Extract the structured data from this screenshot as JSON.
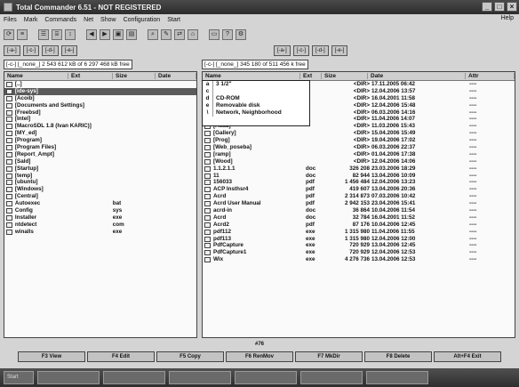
{
  "window": {
    "title": "Total Commander 6.51 - NOT REGISTERED"
  },
  "menu": {
    "items": [
      "Files",
      "Mark",
      "Commands",
      "Net",
      "Show",
      "Configuration",
      "Start"
    ],
    "help": "Help"
  },
  "left_panel": {
    "path": "[-c-] [_none_] 2 543 612 kB of 6 297 468 kB free",
    "columns": [
      "Name",
      "Ext",
      "Size",
      "Date"
    ],
    "rows": [
      [
        "[..]",
        "",
        "",
        ""
      ],
      [
        "[ide-sys]",
        "",
        "",
        ""
      ],
      [
        "[Acoib]",
        "",
        "",
        ""
      ],
      [
        "[Documents and Settings]",
        "",
        "",
        ""
      ],
      [
        "[Freebsd]",
        "",
        "",
        ""
      ],
      [
        "[Intel]",
        "",
        "",
        ""
      ],
      [
        "[MacroSDL 1.8 (Ivan KARIC)]",
        "",
        "",
        ""
      ],
      [
        "[MY_ed]",
        "",
        "",
        ""
      ],
      [
        "[Program]",
        "",
        "",
        ""
      ],
      [
        "[Program Files]",
        "",
        "",
        ""
      ],
      [
        "[Report_Ampt]",
        "",
        "",
        ""
      ],
      [
        "[Sald]",
        "",
        "",
        ""
      ],
      [
        "[Startup]",
        "",
        "",
        ""
      ],
      [
        "[temp]",
        "",
        "",
        ""
      ],
      [
        "[ubuntu]",
        "",
        "",
        ""
      ],
      [
        "[Windows]",
        "",
        "",
        ""
      ],
      [
        "[Central]",
        "",
        "",
        ""
      ],
      [
        "Autoexec",
        "bat",
        "",
        ""
      ],
      [
        "Config",
        "sys",
        "",
        ""
      ],
      [
        "Installer",
        "exe",
        "",
        ""
      ],
      [
        "ntdetect",
        "com",
        "",
        ""
      ],
      [
        "winalls",
        "exe",
        "",
        ""
      ]
    ]
  },
  "right_panel": {
    "path": "[-c-] [_none_] 345 180 of 511 456 k free",
    "columns": [
      "Name",
      "Ext",
      "Size",
      "Date",
      "Attr"
    ],
    "rows": [
      [
        "[..]",
        "",
        "<DIR>",
        "17.11.2005 06:42",
        "----"
      ],
      [
        "[..]",
        "",
        "<DIR>",
        "12.04.2006 13:57",
        "----"
      ],
      [
        "[..]",
        "",
        "<DIR>",
        "16.04.2001 11:58",
        "----"
      ],
      [
        "[..]",
        "",
        "<DIR>",
        "12.04.2006 15:48",
        "----"
      ],
      [
        "[..]",
        "",
        "<DIR>",
        "06.03.2006 14:16",
        "----"
      ],
      [
        "[..]",
        "",
        "<DIR>",
        "11.04.2006 14:07",
        "----"
      ],
      [
        "[Acad]",
        "",
        "<DIR>",
        "11.03.2006 15:43",
        "----"
      ],
      [
        "[Gallery]",
        "",
        "<DIR>",
        "15.04.2006 15:49",
        "----"
      ],
      [
        "[Prog]",
        "",
        "<DIR>",
        "19.04.2006 17:02",
        "----"
      ],
      [
        "[Web_poseba]",
        "",
        "<DIR>",
        "06.03.2006 22:37",
        "----"
      ],
      [
        "[ramp]",
        "",
        "<DIR>",
        "01.04.2006 17:38",
        "----"
      ],
      [
        "[Wood]",
        "",
        "<DIR>",
        "12.04.2006 14:06",
        "----"
      ],
      [
        "1.1.2.1.1",
        "doc",
        "326 208",
        "23.03.2006 18:29",
        "----"
      ],
      [
        "11",
        "doc",
        "82 944",
        "13.04.2006 10:09",
        "----"
      ],
      [
        "156033",
        "pdf",
        "1 456 484",
        "12.04.2006 13:23",
        "----"
      ],
      [
        "ACP Insthsr4",
        "pdf",
        "419 607",
        "13.04.2006 20:36",
        "----"
      ],
      [
        "Acrd",
        "pdf",
        "2 314 873",
        "07.03.2006 10:42",
        "----"
      ],
      [
        "Acrd User Manual",
        "pdf",
        "2 942 153",
        "23.04.2006 15:41",
        "----"
      ],
      [
        "acrd-in",
        "doc",
        "36 864",
        "10.04.2006 11:54",
        "----"
      ],
      [
        "Acrd",
        "doc",
        "32 784",
        "16.04.2001 11:52",
        "----"
      ],
      [
        "Acrd2",
        "pdf",
        "87 176",
        "10.04.2006 12:45",
        "----"
      ],
      [
        "pdf112",
        "exe",
        "1 315 980",
        "11.04.2006 11:55",
        "----"
      ],
      [
        "pdf113",
        "exe",
        "1 315 980",
        "12.04.2006 12:00",
        "----"
      ],
      [
        "PdfCapture",
        "exe",
        "720 929",
        "13.04.2006 12:45",
        "----"
      ],
      [
        "PdfCapture1",
        "exe",
        "720 929",
        "12.04.2006 12:53",
        "----"
      ],
      [
        "Wix",
        "exe",
        "4 276 736",
        "13.04.2006 12:53",
        "----"
      ]
    ]
  },
  "dropdown": {
    "items": [
      {
        "key": "a",
        "label": "3 1/2\""
      },
      {
        "key": "c",
        "label": ""
      },
      {
        "key": "d",
        "label": "CD-ROM"
      },
      {
        "key": "e",
        "label": "Removable disk"
      },
      {
        "key": "\\",
        "label": "Network, Neighborhood"
      }
    ]
  },
  "status": "#76",
  "fkeys": [
    "F3 View",
    "F4 Edit",
    "F5 Copy",
    "F6 RenMov",
    "F7 MkDir",
    "F8 Delete",
    "Alt+F4 Exit"
  ],
  "taskbar": {
    "items": [
      "Start",
      "",
      "",
      "",
      "",
      "",
      ""
    ]
  }
}
